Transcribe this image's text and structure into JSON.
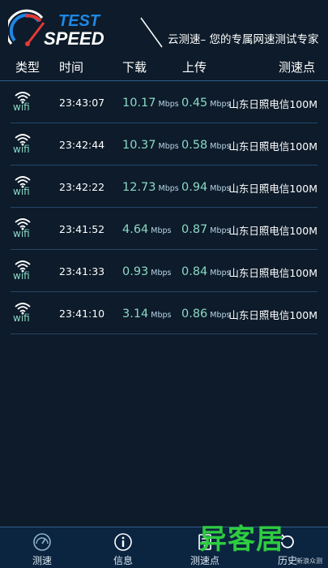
{
  "header": {
    "logo_text_top": "TEST",
    "logo_text_bottom": "SPEED",
    "slogan": "云测速– 您的专属网速测试专家"
  },
  "columns": {
    "type": "类型",
    "time": "时间",
    "download": "下载",
    "upload": "上传",
    "node": "测速点"
  },
  "rows": [
    {
      "type": "wifi",
      "time": "23:43:07",
      "down": "10.17",
      "down_unit": "Mbps",
      "up": "0.45",
      "up_unit": "Mbps",
      "node": "山东日照电信100M"
    },
    {
      "type": "wifi",
      "time": "23:42:44",
      "down": "10.37",
      "down_unit": "Mbps",
      "up": "0.58",
      "up_unit": "Mbps",
      "node": "山东日照电信100M"
    },
    {
      "type": "wifi",
      "time": "23:42:22",
      "down": "12.73",
      "down_unit": "Mbps",
      "up": "0.94",
      "up_unit": "Mbps",
      "node": "山东日照电信100M"
    },
    {
      "type": "wifi",
      "time": "23:41:52",
      "down": "4.64",
      "down_unit": "Mbps",
      "up": "0.87",
      "up_unit": "Mbps",
      "node": "山东日照电信100M"
    },
    {
      "type": "wifi",
      "time": "23:41:33",
      "down": "0.93",
      "down_unit": "Mbps",
      "up": "0.84",
      "up_unit": "Mbps",
      "node": "山东日照电信100M"
    },
    {
      "type": "wifi",
      "time": "23:41:10",
      "down": "3.14",
      "down_unit": "Mbps",
      "up": "0.86",
      "up_unit": "Mbps",
      "node": "山东日照电信100M"
    }
  ],
  "tabs": [
    {
      "label": "测速",
      "icon": "speedometer-icon"
    },
    {
      "label": "信息",
      "icon": "info-icon"
    },
    {
      "label": "测速点",
      "icon": "server-icon"
    },
    {
      "label": "历史",
      "icon": "history-icon"
    }
  ],
  "watermark": {
    "text": "异客居",
    "small": "新浪众测"
  },
  "colors": {
    "background": "#0d1b2a",
    "accent": "#8bd9c4",
    "divider": "#2f5f8a",
    "watermark": "#2ecc40"
  }
}
